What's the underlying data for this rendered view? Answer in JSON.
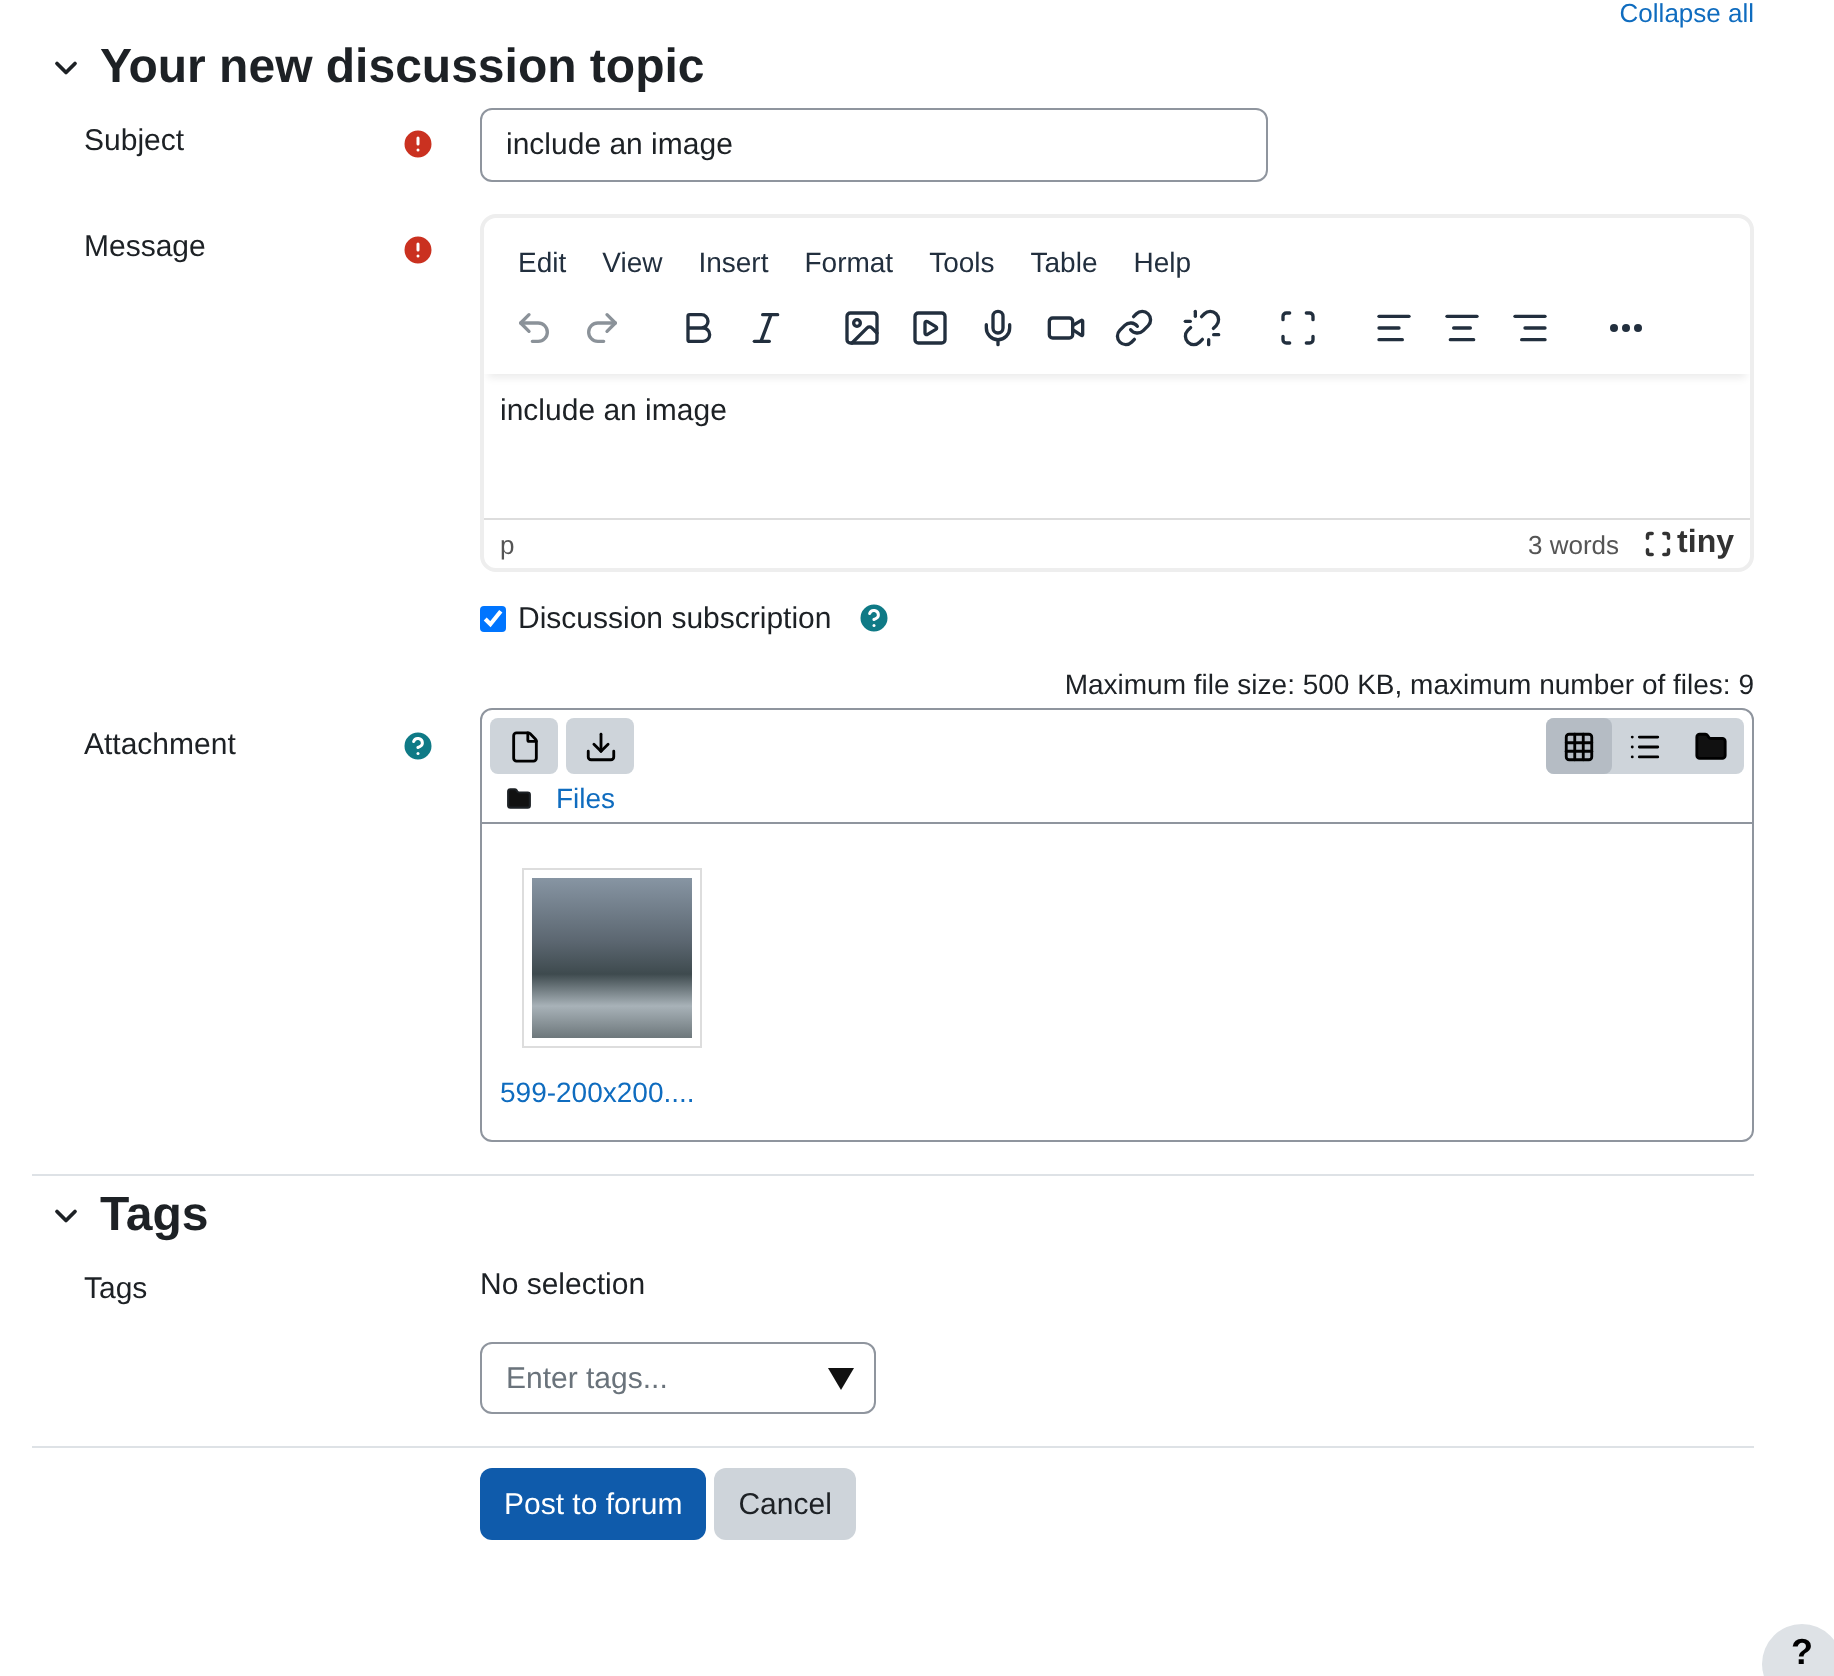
{
  "collapse_all": "Collapse all",
  "topic_section": {
    "title": "Your new discussion topic",
    "expanded": true
  },
  "subject": {
    "label": "Subject",
    "value": "include an image"
  },
  "message": {
    "label": "Message",
    "menu": [
      "Edit",
      "View",
      "Insert",
      "Format",
      "Tools",
      "Table",
      "Help"
    ],
    "content": "include an image",
    "path": "p",
    "word_count": "3 words",
    "brand": "tiny"
  },
  "subscription": {
    "label": "Discussion subscription",
    "checked": true
  },
  "attachment": {
    "label": "Attachment",
    "limits": "Maximum file size: 500 KB, maximum number of files: 9",
    "breadcrumb": "Files",
    "views": [
      {
        "kind": "grid",
        "selected": true
      },
      {
        "kind": "list",
        "selected": false
      },
      {
        "kind": "tree",
        "selected": false
      }
    ],
    "files": [
      {
        "name": "599-200x200...."
      }
    ]
  },
  "tags_section": {
    "title": "Tags",
    "expanded": true
  },
  "tags": {
    "label": "Tags",
    "selection": "No selection",
    "placeholder": "Enter tags..."
  },
  "buttons": [
    {
      "label": "Post to forum",
      "kind": "primary"
    },
    {
      "label": "Cancel",
      "kind": "secondary"
    }
  ],
  "help_button": "?"
}
